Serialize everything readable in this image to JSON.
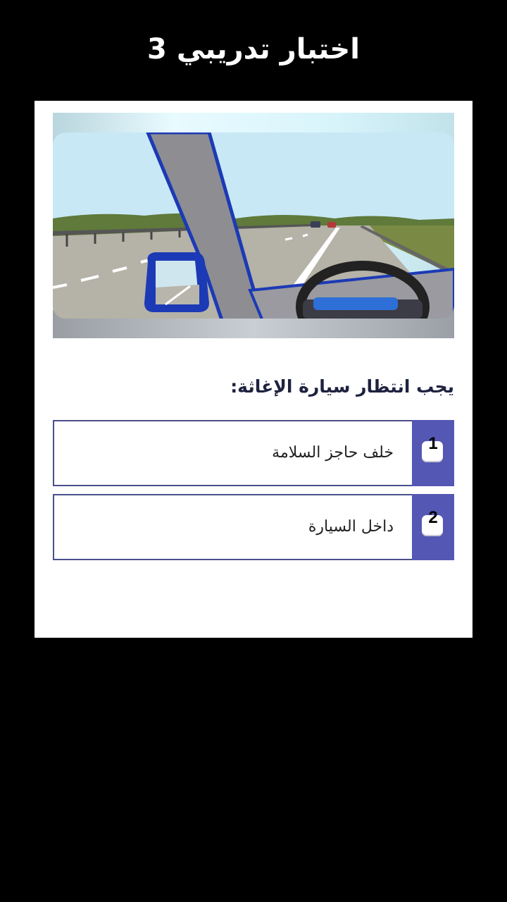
{
  "header": {
    "title": "اختبار تدريبي 3"
  },
  "quiz": {
    "question": "يجب انتظار سيارة الإغاثة:",
    "answers": [
      {
        "number": "1",
        "text": "خلف حاجز السلامة"
      },
      {
        "number": "2",
        "text": "داخل السيارة"
      }
    ]
  },
  "colors": {
    "background": "#000000",
    "card": "#ffffff",
    "accent": "#5457b3",
    "border": "#4a4f8c"
  }
}
